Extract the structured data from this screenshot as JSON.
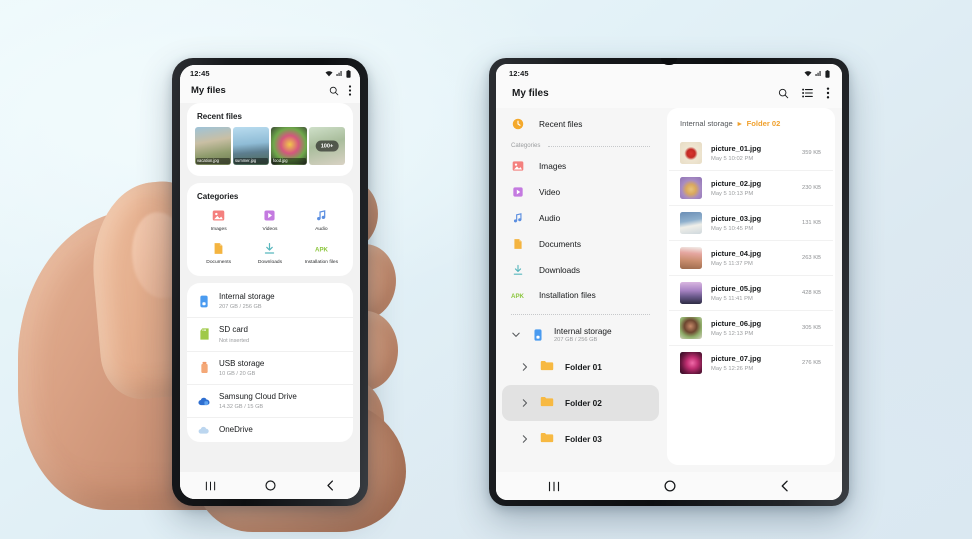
{
  "background": {
    "gradient_from": "#eef9fb",
    "gradient_to": "#d9e6ef"
  },
  "accent": {
    "folder_orange": "#f0a12e",
    "selected_bg": "#e2e2e2"
  },
  "phone": {
    "status": {
      "time": "12:45",
      "wifi_icon": "wifi-icon",
      "signal_icon": "signal-icon",
      "battery_icon": "battery-icon"
    },
    "header": {
      "title": "My files",
      "search_icon": "search-icon",
      "more_icon": "more-vertical-icon"
    },
    "recent": {
      "title": "Recent files",
      "items": [
        {
          "label": "vacation.jpg",
          "badge": ""
        },
        {
          "label": "summer.jpg",
          "badge": ""
        },
        {
          "label": "food.jpg",
          "badge": ""
        },
        {
          "label": "",
          "badge": "100+"
        }
      ]
    },
    "categories": {
      "title": "Categories",
      "items": [
        {
          "label": "Images",
          "icon": "image-icon"
        },
        {
          "label": "Videos",
          "icon": "video-icon"
        },
        {
          "label": "Audio",
          "icon": "audio-icon"
        },
        {
          "label": "Documents",
          "icon": "document-icon"
        },
        {
          "label": "Downloads",
          "icon": "download-icon"
        },
        {
          "label": "Installation files",
          "icon": "apk-icon"
        }
      ]
    },
    "storage": [
      {
        "name": "Internal storage",
        "sub": "207 GB / 256 GB",
        "icon": "internal-storage-icon"
      },
      {
        "name": "SD card",
        "sub": "Not inserted",
        "icon": "sd-card-icon"
      },
      {
        "name": "USB storage",
        "sub": "10 GB / 20 GB",
        "icon": "usb-storage-icon"
      },
      {
        "name": "Samsung Cloud Drive",
        "sub": "14.32 GB / 15 GB",
        "icon": "cloud-drive-icon"
      },
      {
        "name": "OneDrive",
        "sub": "",
        "icon": "onedrive-icon"
      }
    ],
    "navbar": {
      "recents": "recents-icon",
      "home": "home-icon",
      "back": "back-icon"
    }
  },
  "tablet": {
    "status": {
      "time": "12:45",
      "wifi_icon": "wifi-icon",
      "signal_icon": "signal-icon",
      "battery_icon": "battery-icon"
    },
    "header": {
      "title": "My files",
      "search_icon": "search-icon",
      "list_view_icon": "list-view-icon",
      "more_icon": "more-vertical-icon"
    },
    "nav": {
      "recent_files": {
        "label": "Recent files",
        "icon": "recent-clock-icon"
      },
      "categories_label": "Categories",
      "categories": [
        {
          "label": "Images",
          "icon": "image-icon"
        },
        {
          "label": "Video",
          "icon": "video-icon"
        },
        {
          "label": "Audio",
          "icon": "audio-icon"
        },
        {
          "label": "Documents",
          "icon": "document-icon"
        },
        {
          "label": "Downloads",
          "icon": "download-icon"
        },
        {
          "label": "Installation files",
          "icon": "apk-icon"
        }
      ],
      "internal_storage": {
        "name": "Internal storage",
        "sub": "207 GB / 256 GB",
        "icon": "internal-storage-icon"
      },
      "folders": [
        {
          "label": "Folder 01",
          "selected": false
        },
        {
          "label": "Folder 02",
          "selected": true
        },
        {
          "label": "Folder 03",
          "selected": false
        }
      ]
    },
    "breadcrumb": {
      "root": "Internal storage",
      "separator": "▸",
      "current": "Folder 02"
    },
    "files": [
      {
        "name": "picture_01.jpg",
        "date": "May 5 10:02 PM",
        "size": "359 KB"
      },
      {
        "name": "picture_02.jpg",
        "date": "May 5 10:13 PM",
        "size": "230 KB"
      },
      {
        "name": "picture_03.jpg",
        "date": "May 5 10:45 PM",
        "size": "131 KB"
      },
      {
        "name": "picture_04.jpg",
        "date": "May 5 11:37 PM",
        "size": "263 KB"
      },
      {
        "name": "picture_05.jpg",
        "date": "May 5 11:41 PM",
        "size": "428 KB"
      },
      {
        "name": "picture_06.jpg",
        "date": "May 5 12:13 PM",
        "size": "305 KB"
      },
      {
        "name": "picture_07.jpg",
        "date": "May 5 12:26 PM",
        "size": "276 KB"
      }
    ],
    "navbar": {
      "recents": "recents-icon",
      "home": "home-icon",
      "back": "back-icon"
    }
  }
}
